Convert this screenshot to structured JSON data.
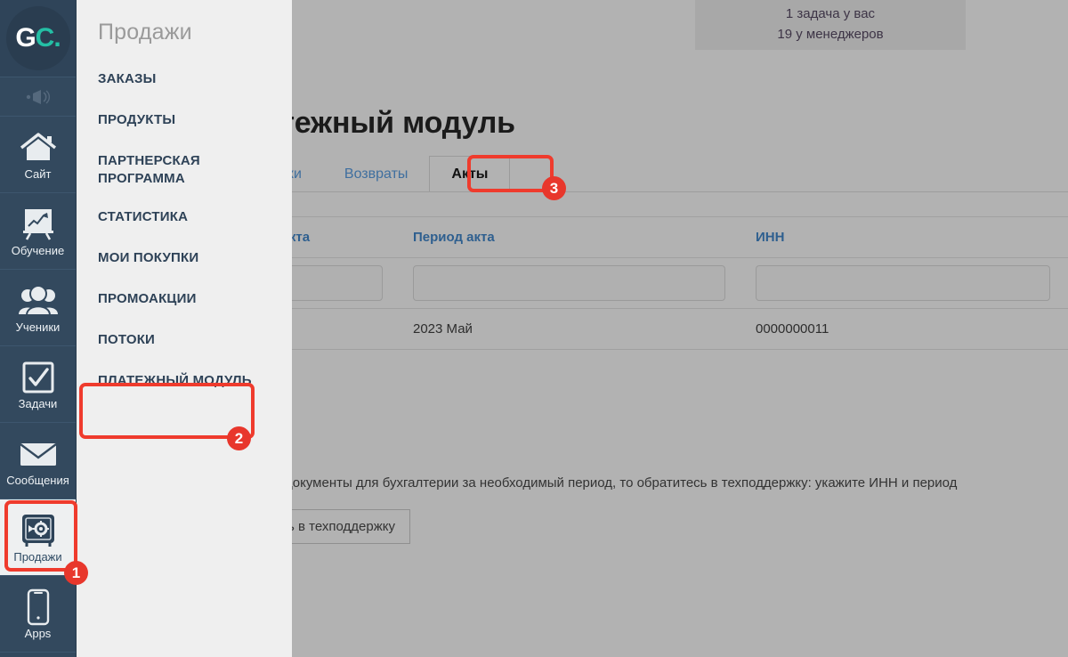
{
  "app": {
    "logo_g": "G",
    "logo_c": "C."
  },
  "rail": {
    "items": [
      {
        "label": "",
        "icon": "megaphone-icon"
      },
      {
        "label": "Сайт",
        "icon": "home-icon"
      },
      {
        "label": "Обучение",
        "icon": "chart-board-icon"
      },
      {
        "label": "Ученики",
        "icon": "users-icon"
      },
      {
        "label": "Задачи",
        "icon": "checkbox-icon"
      },
      {
        "label": "Сообщения",
        "icon": "envelope-icon"
      },
      {
        "label": "Продажи",
        "icon": "safe-icon"
      },
      {
        "label": "Apps",
        "icon": "phone-icon"
      }
    ]
  },
  "panel": {
    "title": "Продажи",
    "items": [
      "ЗАКАЗЫ",
      "ПРОДУКТЫ",
      "ПАРТНЕРСКАЯ ПРОГРАММА",
      "СТАТИСТИКА",
      "МОИ ПОКУПКИ",
      "ПРОМОАКЦИИ",
      "ПОТОКИ",
      "ПЛАТЕЖНЫЙ МОДУЛЬ"
    ]
  },
  "header": {
    "tasks_line1": "1 задача у вас",
    "tasks_line2": "19 у менеджеров"
  },
  "main": {
    "page_title": "Платежный модуль",
    "tabs": [
      {
        "label": "Платежи",
        "active": false
      },
      {
        "label": "Возвраты",
        "active": false
      },
      {
        "label": "Акты",
        "active": true
      }
    ],
    "table": {
      "columns": [
        "Номер акта",
        "Период акта",
        "ИНН"
      ],
      "filters": [
        "",
        "",
        ""
      ],
      "filter_placeholder": "",
      "rows": [
        [
          "",
          "2023 Май",
          "0000000011"
        ]
      ]
    },
    "note": "Если вам нужны закрывающие документы для бухгалтерии за необходимый период, то обратитесь в техподдержку: укажите ИНН и период",
    "support_button": "Написать в техподдержку"
  },
  "annotations": {
    "steps": [
      {
        "number": "1",
        "target": "Продажи"
      },
      {
        "number": "2",
        "target": "ПЛАТЕЖНЫЙ МОДУЛЬ"
      },
      {
        "number": "3",
        "target": "Акты"
      }
    ],
    "color": "#e8372c"
  }
}
